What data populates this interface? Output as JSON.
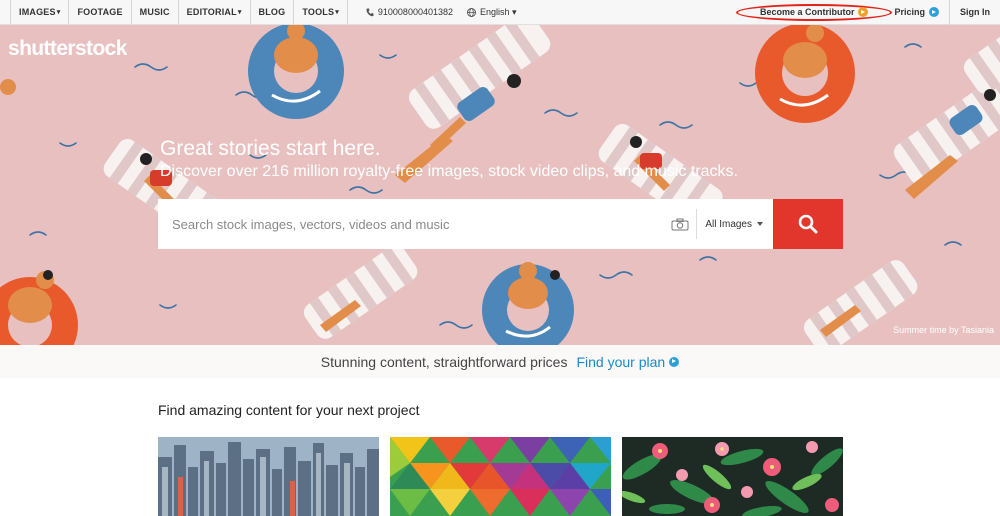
{
  "nav": {
    "tabs": [
      {
        "label": "IMAGES",
        "caret": "▾"
      },
      {
        "label": "FOOTAGE",
        "caret": ""
      },
      {
        "label": "MUSIC",
        "caret": ""
      },
      {
        "label": "EDITORIAL",
        "caret": "▾"
      },
      {
        "label": "BLOG",
        "caret": ""
      },
      {
        "label": "TOOLS",
        "caret": "▾"
      }
    ],
    "phone": "910008000401382",
    "language": "English ▾",
    "contributor": "Become a Contributor",
    "pricing": "Pricing",
    "signin": "Sign In",
    "accent": "#f0a030",
    "pricing_accent": "#2d9fd9",
    "highlight": "#e2231a"
  },
  "hero": {
    "logo": "shutterstock",
    "headline": "Great stories start here.",
    "subhead": "Discover over 216 million royalty-free images, stock video clips, and music tracks.",
    "search_placeholder": "Search stock images, vectors, videos and music",
    "filter": "All Images",
    "credit": "Summer time by Tasiania",
    "search_color": "#e2352c"
  },
  "promo": {
    "text": "Stunning content, straightforward prices",
    "link": "Find your plan"
  },
  "content": {
    "title": "Find amazing content for your next project",
    "thumbnails": [
      "city-skyline-thumbnail",
      "colorful-triangles-thumbnail",
      "tropical-flowers-thumbnail"
    ]
  }
}
